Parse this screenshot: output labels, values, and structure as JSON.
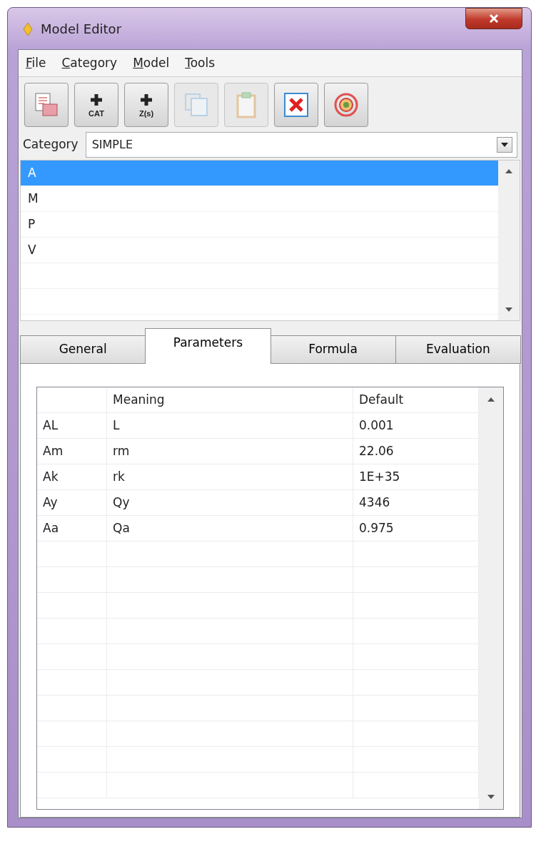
{
  "window": {
    "title": "Model Editor"
  },
  "menu": [
    {
      "mnemonic": "F",
      "rest": "ile"
    },
    {
      "mnemonic": "C",
      "rest": "ategory"
    },
    {
      "mnemonic": "M",
      "rest": "odel"
    },
    {
      "mnemonic": "T",
      "rest": "ools"
    }
  ],
  "toolbar": [
    {
      "kind": "open",
      "disabled": false
    },
    {
      "kind": "add-category",
      "label": "CAT",
      "disabled": false
    },
    {
      "kind": "add-model",
      "label": "Z(s)",
      "disabled": false
    },
    {
      "kind": "copy",
      "disabled": true
    },
    {
      "kind": "paste",
      "disabled": true
    },
    {
      "kind": "delete",
      "disabled": false
    },
    {
      "kind": "target",
      "disabled": false
    }
  ],
  "category": {
    "label": "Category",
    "value": "SIMPLE"
  },
  "models": [
    {
      "name": "A",
      "selected": true
    },
    {
      "name": "M",
      "selected": false
    },
    {
      "name": "P",
      "selected": false
    },
    {
      "name": "V",
      "selected": false
    }
  ],
  "tabs": [
    {
      "label": "General",
      "selected": false
    },
    {
      "label": "Parameters",
      "selected": true
    },
    {
      "label": "Formula",
      "selected": false
    },
    {
      "label": "Evaluation",
      "selected": false
    }
  ],
  "table": {
    "columns": [
      "Meaning",
      "Default"
    ],
    "rows": [
      {
        "name": "AL",
        "meaning": "L",
        "default": "0.001"
      },
      {
        "name": "Am",
        "meaning": "rm",
        "default": "22.06"
      },
      {
        "name": "Ak",
        "meaning": "rk",
        "default": "1E+35"
      },
      {
        "name": "Ay",
        "meaning": "Qy",
        "default": "4346"
      },
      {
        "name": "Aa",
        "meaning": "Qa",
        "default": "0.975"
      }
    ]
  }
}
